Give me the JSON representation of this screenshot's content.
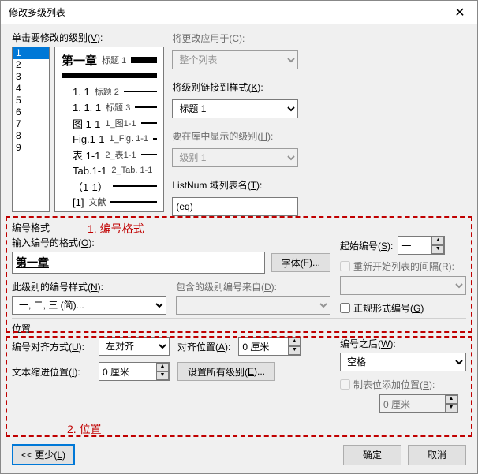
{
  "titlebar": {
    "title": "修改多级列表"
  },
  "levels": {
    "label_pre": "单击要修改的级别(",
    "label_key": "V",
    "label_post": "):",
    "items": [
      "1",
      "2",
      "3",
      "4",
      "5",
      "6",
      "7",
      "8",
      "9"
    ],
    "selected": "1"
  },
  "preview_lines": [
    {
      "t1": "第一章",
      "t2": "标题 1",
      "bold": true,
      "thick": 1
    },
    {
      "t1": "",
      "t2": "",
      "thick": 2,
      "indent": 0
    },
    {
      "t1": "1. 1",
      "t2": "标题 2",
      "indent": 1
    },
    {
      "t1": "1. 1. 1",
      "t2": "标题 3",
      "indent": 1
    },
    {
      "t1": "图 1-1",
      "t2": "1_图1-1",
      "indent": 1
    },
    {
      "t1": "Fig.1-1",
      "t2": "1_Fig. 1-1",
      "indent": 1
    },
    {
      "t1": "表 1-1",
      "t2": "2_表1-1",
      "indent": 1
    },
    {
      "t1": "Tab.1-1",
      "t2": "2_Tab. 1-1",
      "indent": 1
    },
    {
      "t1": "（1-1）",
      "t2": "",
      "indent": 1
    },
    {
      "t1": "[1]",
      "t2": "文献",
      "indent": 1
    }
  ],
  "right": {
    "apply_to": {
      "label_pre": "将更改应用于(",
      "key": "C",
      "label_post": "):",
      "value": "整个列表"
    },
    "link_style": {
      "label_pre": "将级别链接到样式(",
      "key": "K",
      "label_post": "):",
      "value": "标题 1"
    },
    "gallery_level": {
      "label_pre": "要在库中显示的级别(",
      "key": "H",
      "label_post": "):",
      "value": "级别 1"
    },
    "listnum": {
      "label_pre": "ListNum 域列表名(",
      "key": "T",
      "label_post": "):",
      "value": "(eq)"
    }
  },
  "red1": {
    "label": "1. 编号格式",
    "title": "编号格式"
  },
  "fmt": {
    "input_label_pre": "输入编号的格式(",
    "input_key": "O",
    "input_label_post": "):",
    "input_value": "第一章",
    "font_btn_pre": "字体(",
    "font_key": "F",
    "font_btn_post": ")...",
    "style_label_pre": "此级别的编号样式(",
    "style_key": "N",
    "style_label_post": "):",
    "style_value": "一, 二, 三 (简)...",
    "include_label_pre": "包含的级别编号来自(",
    "include_key": "D",
    "include_label_post": "):",
    "start_label_pre": "起始编号(",
    "start_key": "S",
    "start_label_post": "):",
    "start_value": "一",
    "restart_label_pre": "重新开始列表的间隔(",
    "restart_key": "R",
    "restart_label_post": "):",
    "legal_label_pre": "正规形式编号(",
    "legal_key": "G",
    "legal_label_post": ")"
  },
  "red2": {
    "label": "2. 位置",
    "title": "位置"
  },
  "pos": {
    "align_label_pre": "编号对齐方式(",
    "align_key": "U",
    "align_label_post": "):",
    "align_value": "左对齐",
    "align_at_pre": "对齐位置(",
    "align_at_key": "A",
    "align_at_post": "):",
    "align_at_value": "0 厘米",
    "indent_label_pre": "文本缩进位置(",
    "indent_key": "I",
    "indent_label_post": "):",
    "indent_value": "0 厘米",
    "set_all_pre": "设置所有级别(",
    "set_all_key": "E",
    "set_all_post": ")...",
    "follow_label_pre": "编号之后(",
    "follow_key": "W",
    "follow_label_post": "):",
    "follow_value": "空格",
    "tab_label_pre": "制表位添加位置(",
    "tab_key": "B",
    "tab_label_post": "):",
    "tab_value": "0 厘米"
  },
  "footer": {
    "less_pre": "<< 更少(",
    "less_key": "L",
    "less_post": ")",
    "ok": "确定",
    "cancel": "取消"
  }
}
